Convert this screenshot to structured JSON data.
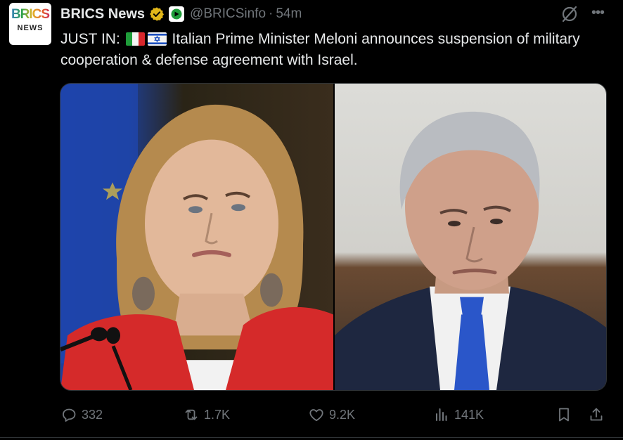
{
  "author": {
    "avatar_top": "BRICS",
    "avatar_bottom": "NEWS",
    "display_name": "BRICS News",
    "handle": "@BRICSinfo",
    "separator": "·",
    "time": "54m"
  },
  "post": {
    "text_prefix": "JUST IN:",
    "flags": [
      "italy-flag",
      "israel-flag"
    ],
    "text_body": "Italian Prime Minister Meloni announces suspension of military cooperation & defense agreement with Israel."
  },
  "colors": {
    "background": "#000000",
    "text": "#e7e9ea",
    "secondary": "#71767b",
    "verified_gold": "#e2b719"
  },
  "actions": {
    "replies": "332",
    "reposts": "1.7K",
    "likes": "9.2K",
    "views": "141K"
  }
}
